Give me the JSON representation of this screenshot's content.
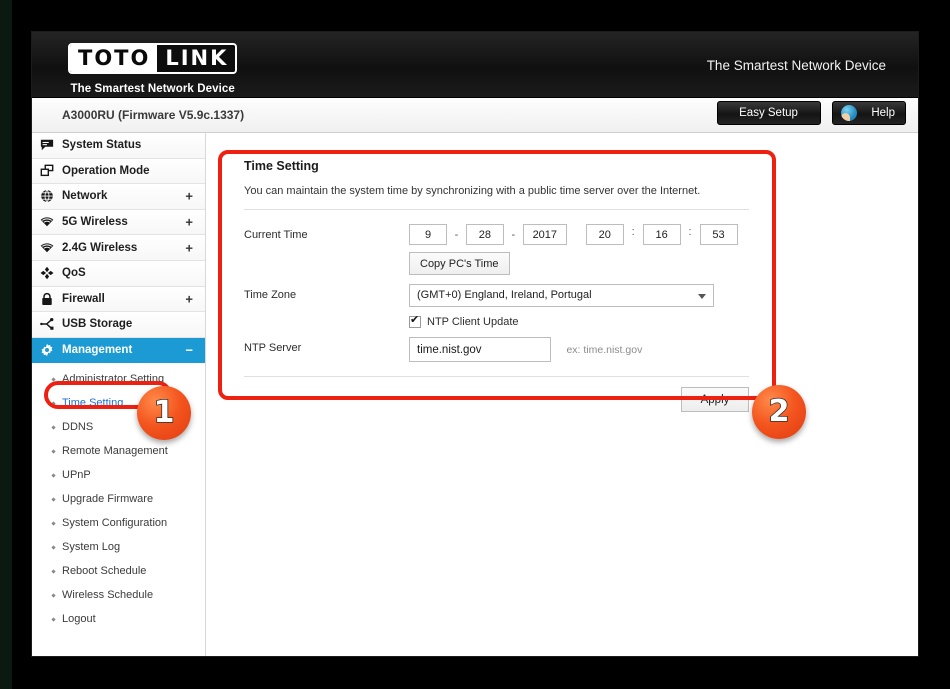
{
  "header": {
    "logo_left": "TOTO",
    "logo_right": "LINK",
    "logo_tagline": "The Smartest Network Device",
    "slogan": "The Smartest Network Device"
  },
  "modelbar": {
    "model": "A3000RU (Firmware V5.9c.1337)",
    "easy_setup": "Easy Setup",
    "help": "Help"
  },
  "sidebar": {
    "items": [
      {
        "label": "System Status",
        "icon": "speech-bubble-icon",
        "expand": ""
      },
      {
        "label": "Operation Mode",
        "icon": "windows-icon",
        "expand": ""
      },
      {
        "label": "Network",
        "icon": "globe-icon",
        "expand": "+"
      },
      {
        "label": "5G Wireless",
        "icon": "wifi-icon",
        "expand": "+"
      },
      {
        "label": "2.4G Wireless",
        "icon": "wifi-icon",
        "expand": "+"
      },
      {
        "label": "QoS",
        "icon": "arrows-icon",
        "expand": ""
      },
      {
        "label": "Firewall",
        "icon": "lock-icon",
        "expand": "+"
      },
      {
        "label": "USB Storage",
        "icon": "usb-branch-icon",
        "expand": ""
      },
      {
        "label": "Management",
        "icon": "gear-icon",
        "expand": "−"
      }
    ],
    "submenu": [
      "Administrator Setting",
      "Time Setting",
      "DDNS",
      "Remote Management",
      "UPnP",
      "Upgrade Firmware",
      "System Configuration",
      "System Log",
      "Reboot Schedule",
      "Wireless Schedule",
      "Logout"
    ],
    "current_submenu": "Time Setting"
  },
  "panel": {
    "title": "Time Setting",
    "description": "You can maintain the system time by synchronizing with a public time server over the Internet.",
    "current_time_label": "Current Time",
    "time": {
      "month": "9",
      "day": "28",
      "year": "2017",
      "hour": "20",
      "minute": "16",
      "second": "53",
      "date_sep": "-",
      "time_sep": ":"
    },
    "copy_pc_time": "Copy PC's Time",
    "time_zone_label": "Time Zone",
    "time_zone_value": "(GMT+0) England, Ireland, Portugal",
    "ntp_checkbox_label": "NTP Client Update",
    "ntp_checkbox_checked": true,
    "ntp_server_label": "NTP Server",
    "ntp_server_value": "time.nist.gov",
    "ntp_server_hint": "ex: time.nist.gov",
    "apply": "Apply"
  },
  "annotations": {
    "badge_1": "1",
    "badge_2": "2",
    "highlight_color": "#ee2012"
  }
}
